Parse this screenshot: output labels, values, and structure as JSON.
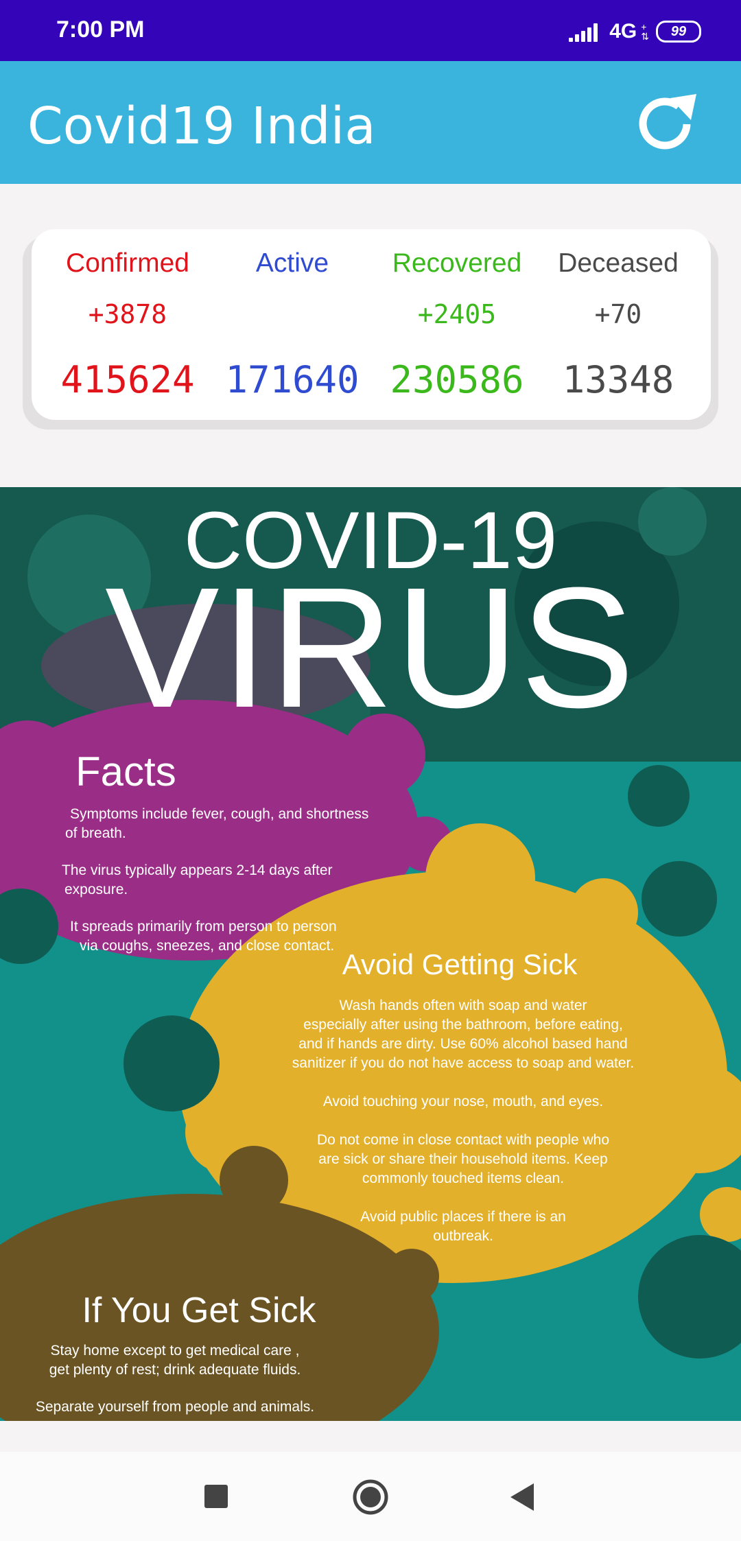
{
  "status": {
    "time": "7:00 PM",
    "network": "4G",
    "battery": "99"
  },
  "header": {
    "title": "Covid19 India",
    "refresh_icon": "refresh-icon"
  },
  "stats": [
    {
      "label": "Confirmed",
      "delta": "+3878",
      "total": "415624",
      "color": "#e0141a"
    },
    {
      "label": "Active",
      "delta": "",
      "total": "171640",
      "color": "#2f4bd0"
    },
    {
      "label": "Recovered",
      "delta": "+2405",
      "total": "230586",
      "color": "#3bb81c"
    },
    {
      "label": "Deceased",
      "delta": "+70",
      "total": "13348",
      "color": "#4a4a4a"
    }
  ],
  "poster": {
    "heading_top": "COVID-19",
    "heading_main": "VIRUS",
    "facts": {
      "title": "Facts",
      "lines": [
        "Symptoms include fever, cough, and shortness",
        "of breath.",
        "The virus typically appears 2-14 days after",
        "exposure.",
        "It spreads primarily from person to person",
        "via coughs, sneezes, and close contact."
      ]
    },
    "avoid": {
      "title": "Avoid Getting Sick",
      "lines": [
        "Wash hands often with soap and water",
        "especially after using the bathroom, before eating,",
        "and if hands are dirty. Use 60% alcohol based hand",
        "sanitizer if you do not have access to soap and water.",
        "Avoid touching your nose, mouth, and eyes.",
        "Do not come in close contact with people who",
        "are sick or share their household items. Keep",
        "commonly touched items clean.",
        "Avoid public places if there is an",
        "outbreak."
      ]
    },
    "sick": {
      "title": "If You Get Sick",
      "lines": [
        "Stay home except to get medical care ,",
        "get plenty of rest; drink adequate fluids.",
        "Separate yourself from people and animals."
      ]
    }
  },
  "navigation": {
    "recents_icon": "square-icon",
    "home_icon": "home-circle-icon",
    "back_icon": "back-triangle-icon"
  }
}
